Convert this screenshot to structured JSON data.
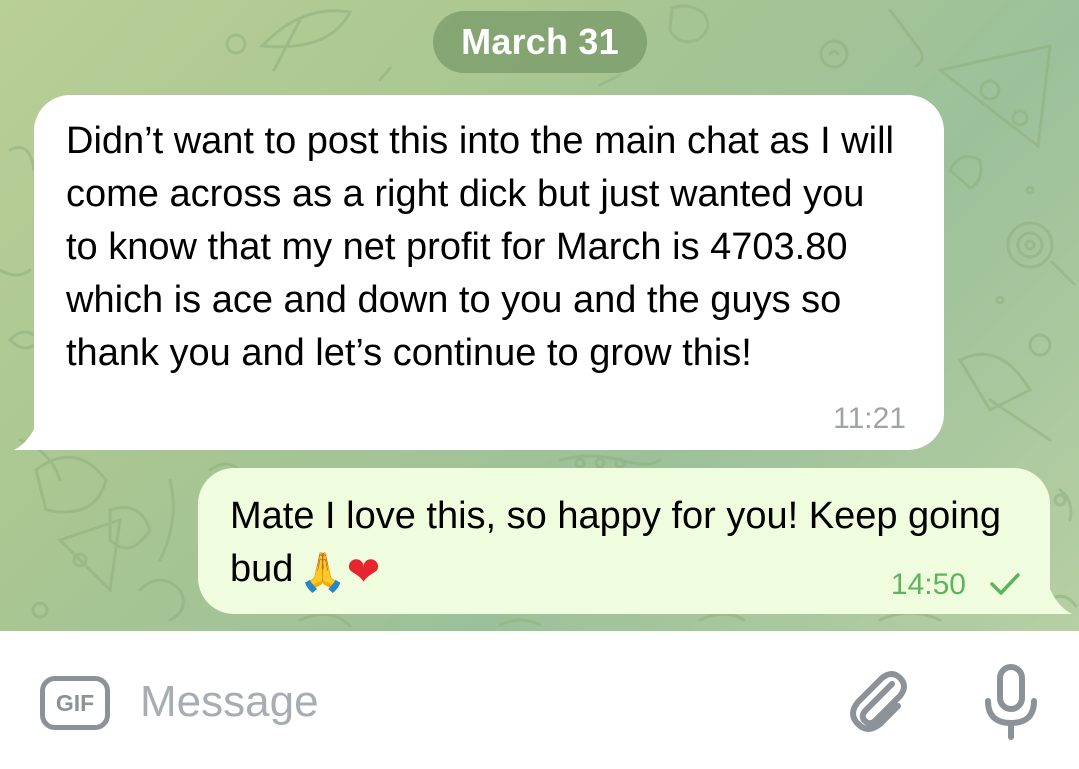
{
  "chat": {
    "date_pill": "March 31",
    "messages": [
      {
        "direction": "incoming",
        "text": "Didn’t want to post this into the main chat as I will come across as a right dick but just wanted you to know that my net profit for March is 4703.80 which is ace and down to you and the guys so thank you and let’s continue to grow this!",
        "time": "11:21"
      },
      {
        "direction": "outgoing",
        "text": "Mate I love this, so happy for you! Keep going bud",
        "emojis": [
          "🙏",
          "❤"
        ],
        "time": "14:50",
        "status_icon": "single-check-icon"
      }
    ]
  },
  "composer": {
    "gif_label": "GIF",
    "placeholder": "Message",
    "attach_icon": "paperclip-icon",
    "voice_icon": "microphone-icon"
  },
  "colors": {
    "incoming_bubble": "#ffffff",
    "outgoing_bubble": "#effdde",
    "outgoing_time": "#5eb45b",
    "incoming_time": "#a0a4a8",
    "date_pill": "#6e9160",
    "icon_gray": "#8c9398"
  }
}
